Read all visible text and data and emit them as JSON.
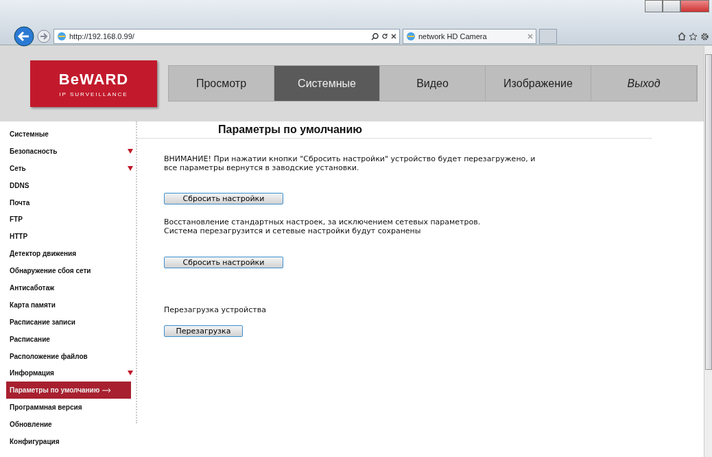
{
  "browser": {
    "url": "http://192.168.0.99/",
    "tab_title": "network HD Camera"
  },
  "logo": {
    "brand": "BeWARD",
    "tagline": "IP SURVEILLANCE"
  },
  "nav": [
    {
      "label": "Просмотр",
      "kind": "tab",
      "selected": false
    },
    {
      "label": "Системные",
      "kind": "tab",
      "selected": true
    },
    {
      "label": "Видео",
      "kind": "tab",
      "selected": false
    },
    {
      "label": "Изображение",
      "kind": "tab",
      "selected": false
    },
    {
      "label": "Выход",
      "kind": "exit",
      "selected": false
    }
  ],
  "sidebar": [
    {
      "label": "Системные",
      "expandable": false,
      "selected": false
    },
    {
      "label": "Безопасность",
      "expandable": true,
      "selected": false
    },
    {
      "label": "Сеть",
      "expandable": true,
      "selected": false
    },
    {
      "label": "DDNS",
      "expandable": false,
      "selected": false
    },
    {
      "label": "Почта",
      "expandable": false,
      "selected": false
    },
    {
      "label": "FTP",
      "expandable": false,
      "selected": false
    },
    {
      "label": "HTTP",
      "expandable": false,
      "selected": false
    },
    {
      "label": "Детектор движения",
      "expandable": false,
      "selected": false
    },
    {
      "label": "Обнаружение сбоя сети",
      "expandable": false,
      "selected": false
    },
    {
      "label": "Антисаботаж",
      "expandable": false,
      "selected": false
    },
    {
      "label": "Карта памяти",
      "expandable": false,
      "selected": false
    },
    {
      "label": "Расписание записи",
      "expandable": false,
      "selected": false
    },
    {
      "label": "Расписание",
      "expandable": false,
      "selected": false
    },
    {
      "label": "Расположение файлов",
      "expandable": false,
      "selected": false
    },
    {
      "label": "Информация",
      "expandable": true,
      "selected": false
    },
    {
      "label": "Параметры по умолчанию",
      "expandable": false,
      "selected": true
    },
    {
      "label": "Программная версия",
      "expandable": false,
      "selected": false
    },
    {
      "label": "Обновление",
      "expandable": false,
      "selected": false
    },
    {
      "label": "Конфигурация",
      "expandable": false,
      "selected": false
    }
  ],
  "content": {
    "title": "Параметры по умолчанию",
    "sections": [
      {
        "text": "ВНИМАНИЕ! При нажатии кнопки \"Сбросить настройки\" устройство будет перезагружено, и все параметры вернутся в заводские установки.",
        "button": "Сбросить настройки",
        "kind": "wide"
      },
      {
        "text": "Восстановление стандартных настроек, за исключением сетевых параметров.\nСистема перезагрузится и сетевые настройки будут сохранены",
        "button": "Сбросить настройки",
        "kind": "wide"
      },
      {
        "text": "Перезагрузка устройства",
        "button": "Перезагрузка",
        "kind": "narrow"
      }
    ]
  }
}
